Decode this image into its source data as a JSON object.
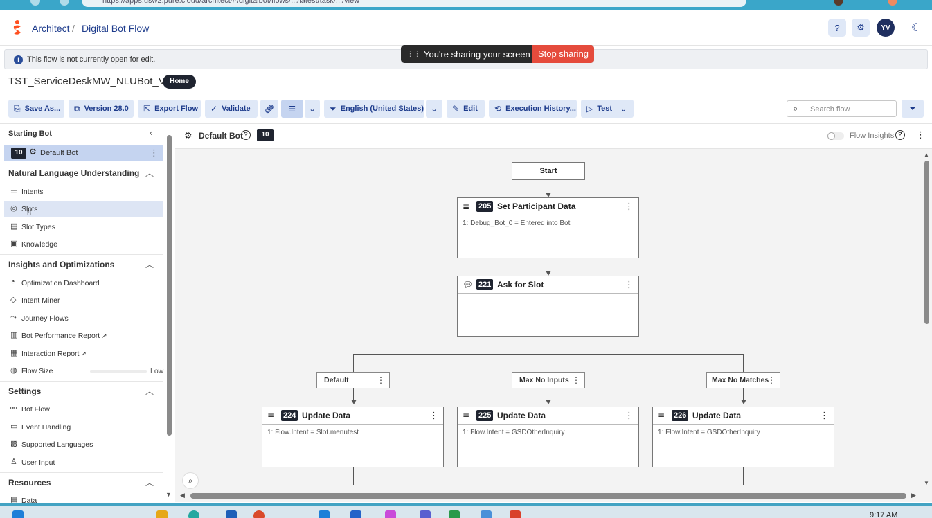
{
  "browser": {
    "url_fragment": "https://apps.usw2.pure.cloud/architect/#/digitalbot/flows/.../latest/task/.../view"
  },
  "header": {
    "crumb_root": "Architect",
    "crumb_sep": "/",
    "crumb_current": "Digital Bot Flow",
    "help_icon": "question-circle-icon",
    "settings_icon": "gear-icon",
    "avatar_initials": "YV",
    "theme_icon": "moon-icon"
  },
  "banner": {
    "text": "This flow is not currently open for edit."
  },
  "share_bar": {
    "text": "You're sharing your screen",
    "stop_label": "Stop sharing"
  },
  "flow": {
    "name": "TST_ServiceDeskMW_NLUBot_V7",
    "badge": "Home"
  },
  "toolbar": {
    "save_as": "Save As...",
    "version": "Version 28.0",
    "export": "Export Flow",
    "validate": "Validate",
    "language": "English (United States)",
    "edit": "Edit",
    "history": "Execution History...",
    "test": "Test",
    "search_placeholder": "Search flow"
  },
  "sidebar": {
    "starting_bot_label": "Starting Bot",
    "default_bot": {
      "number": "10",
      "label": "Default Bot"
    },
    "nlu": {
      "title": "Natural Language Understanding",
      "items": [
        {
          "label": "Intents",
          "icon": "layers-icon"
        },
        {
          "label": "Slots",
          "icon": "target-icon"
        },
        {
          "label": "Slot Types",
          "icon": "document-icon"
        },
        {
          "label": "Knowledge",
          "icon": "book-icon"
        }
      ]
    },
    "insights": {
      "title": "Insights and Optimizations",
      "items": [
        {
          "label": "Optimization Dashboard",
          "icon": "dashboard-icon"
        },
        {
          "label": "Intent Miner",
          "icon": "gem-icon"
        },
        {
          "label": "Journey Flows",
          "icon": "journey-icon"
        },
        {
          "label": "Bot Performance Report",
          "icon": "bar-chart-icon"
        },
        {
          "label": "Interaction Report",
          "icon": "report-icon"
        }
      ],
      "flow_size_label": "Flow Size",
      "flow_size_value": "Low"
    },
    "settings": {
      "title": "Settings",
      "items": [
        {
          "label": "Bot Flow",
          "icon": "flow-icon"
        },
        {
          "label": "Event Handling",
          "icon": "event-icon"
        },
        {
          "label": "Supported Languages",
          "icon": "language-icon"
        },
        {
          "label": "User Input",
          "icon": "microphone-icon"
        }
      ]
    },
    "resources": {
      "title": "Resources",
      "items": [
        {
          "label": "Data",
          "icon": "database-icon"
        }
      ]
    }
  },
  "canvas_header": {
    "title": "Default Bot",
    "badge": "10",
    "insights_label": "Flow Insights"
  },
  "canvas": {
    "start_label": "Start",
    "nodes": [
      {
        "num": "205",
        "title": "Set Participant Data",
        "body": "1: Debug_Bot_0 = Entered into Bot"
      },
      {
        "num": "221",
        "title": "Ask for Slot",
        "body": ""
      },
      {
        "num": "224",
        "title": "Update Data",
        "body": "1: Flow.Intent = Slot.menutest"
      },
      {
        "num": "225",
        "title": "Update Data",
        "body": "1: Flow.Intent = GSDOtherInquiry"
      },
      {
        "num": "226",
        "title": "Update Data",
        "body": "1: Flow.Intent = GSDOtherInquiry"
      }
    ],
    "paths": [
      "Default",
      "Max No Inputs",
      "Max No Matches"
    ]
  },
  "taskbar": {
    "time": "9:17 AM"
  },
  "colors": {
    "brand_orange": "#ff4f1f",
    "accent_blue": "#1e3c8c",
    "button_bg": "#dfe8f7",
    "stop_red": "#e54b3c",
    "dark_badge": "#1f2430"
  }
}
